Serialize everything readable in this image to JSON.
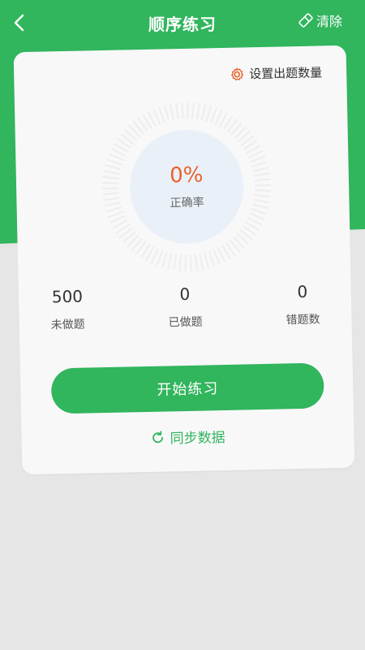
{
  "header": {
    "title": "顺序练习",
    "clear_label": "清除"
  },
  "card": {
    "settings_label": "设置出题数量",
    "accuracy": {
      "value": "0%",
      "label": "正确率"
    },
    "stats": [
      {
        "value": "500",
        "label": "未做题"
      },
      {
        "value": "0",
        "label": "已做题"
      },
      {
        "value": "0",
        "label": "错题数"
      }
    ],
    "start_label": "开始练习",
    "sync_label": "同步数据"
  },
  "colors": {
    "brand": "#31b55d",
    "accent": "#e9632b",
    "background": "#e6e6e6",
    "card": "#f8f8f8"
  }
}
